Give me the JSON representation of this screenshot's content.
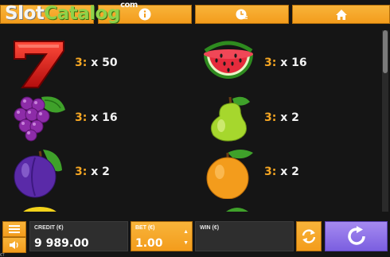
{
  "watermark": {
    "part1": "Slot",
    "part2": "Catalog",
    "suffix": "com"
  },
  "nav": {
    "info_icon": "info-icon",
    "paytable_icon": "clock-list-icon",
    "home_icon": "home-icon"
  },
  "paytable": {
    "rows": [
      {
        "symbol": "seven",
        "pay_count": "3:",
        "pay_mult": "x 50"
      },
      {
        "symbol": "watermelon",
        "pay_count": "3:",
        "pay_mult": "x 16"
      },
      {
        "symbol": "grapes",
        "pay_count": "3:",
        "pay_mult": "x 16"
      },
      {
        "symbol": "pear",
        "pay_count": "3:",
        "pay_mult": "x 2"
      },
      {
        "symbol": "plum",
        "pay_count": "3:",
        "pay_mult": "x 2"
      },
      {
        "symbol": "orange",
        "pay_count": "3:",
        "pay_mult": "x 2"
      }
    ]
  },
  "bottom": {
    "credit_label": "CREDIT (€)",
    "credit_value": "9 989.00",
    "bet_label": "BET (€)",
    "bet_value": "1.00",
    "win_label": "WIN (€)",
    "win_value": "",
    "corner": "€T"
  },
  "colors": {
    "accent": "#f5a623",
    "spin": "#8c6fe8"
  }
}
